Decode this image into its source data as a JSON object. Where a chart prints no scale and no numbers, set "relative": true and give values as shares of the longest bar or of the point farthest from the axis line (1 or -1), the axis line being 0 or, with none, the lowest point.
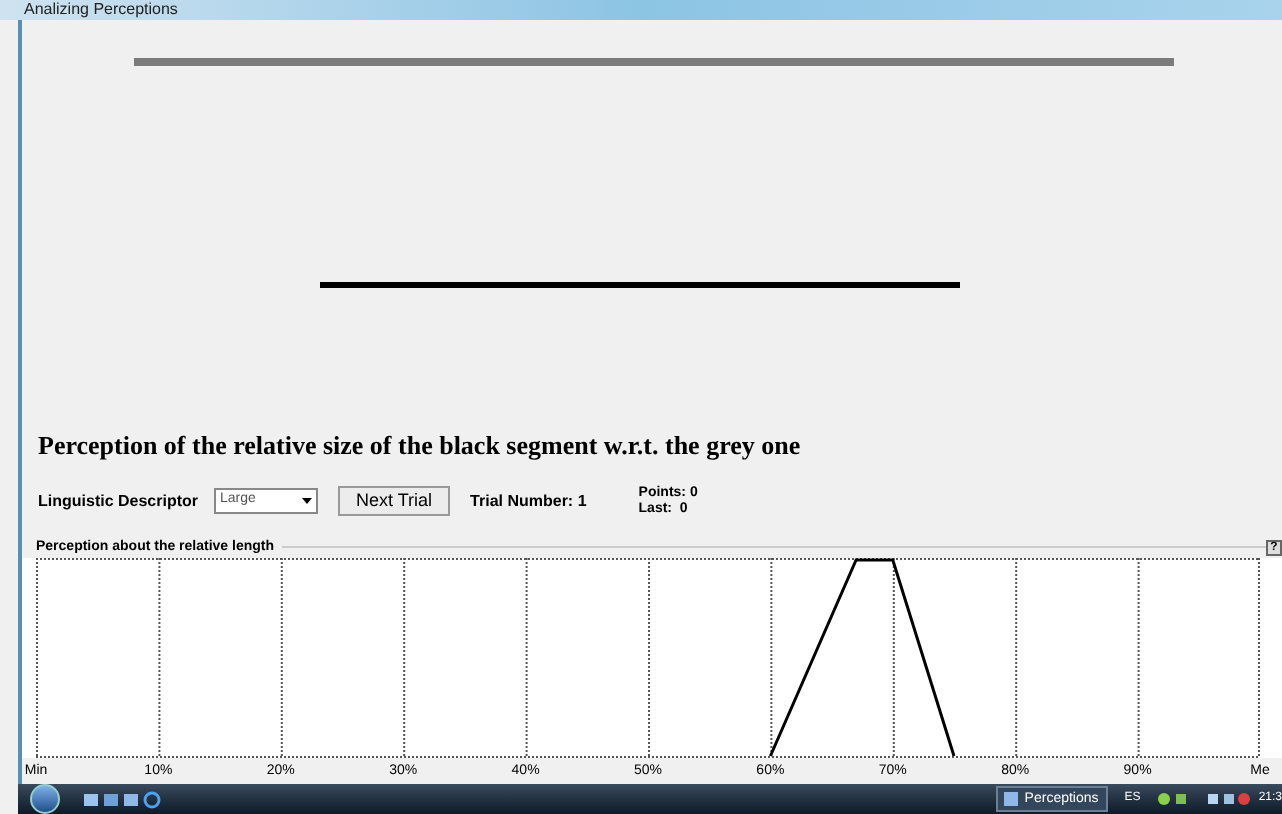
{
  "window": {
    "title": "Analizing Perceptions"
  },
  "heading": "Perception of the relative size of the black segment w.r.t. the grey one",
  "controls": {
    "descriptor_label": "Linguistic Descriptor",
    "descriptor_value": "Large",
    "next_button": "Next Trial",
    "trial_number": "Trial Number: 1",
    "points": "Points: 0",
    "last": "Last:  0"
  },
  "group": {
    "title": "Perception about the relative length",
    "help": "?",
    "chart_data": {
      "type": "line",
      "x": [
        60,
        67,
        70,
        75
      ],
      "series": [
        {
          "color": "#000000",
          "values": [
            0,
            1,
            1,
            0
          ]
        }
      ],
      "xlim": [
        0,
        100
      ],
      "relative": true,
      "grid": true,
      "xticks": [
        {
          "value": 0,
          "label": "Min"
        },
        {
          "value": 10,
          "label": "10%"
        },
        {
          "value": 20,
          "label": "20%"
        },
        {
          "value": 30,
          "label": "30%"
        },
        {
          "value": 40,
          "label": "40%"
        },
        {
          "value": 50,
          "label": "50%"
        },
        {
          "value": 60,
          "label": "60%"
        },
        {
          "value": 70,
          "label": "70%"
        },
        {
          "value": 80,
          "label": "80%"
        },
        {
          "value": 90,
          "label": "90%"
        },
        {
          "value": 100,
          "label": "Me"
        }
      ]
    }
  },
  "taskbar": {
    "task": "Perceptions",
    "language": "ES",
    "clock": "21:3"
  }
}
